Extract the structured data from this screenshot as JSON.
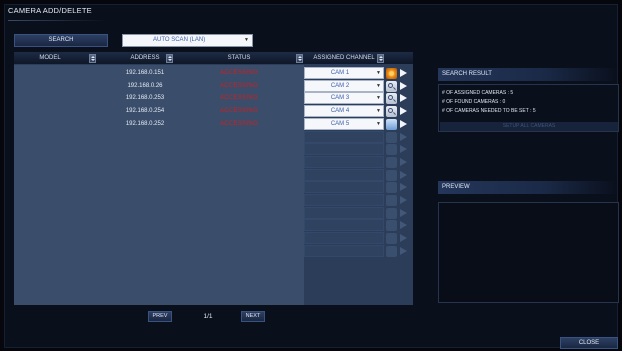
{
  "window": {
    "title": "CAMERA ADD/DELETE"
  },
  "toolbar": {
    "search_label": "SEARCH",
    "scan_mode": "AUTO SCAN (LAN)"
  },
  "table": {
    "columns": {
      "model": "MODEL",
      "address": "ADDRESS",
      "status": "STATUS",
      "channel": "ASSIGNED CHANNEL"
    },
    "rows": [
      {
        "address": "192.168.0.151",
        "status": "ACCESSING",
        "channel": "CAM 1",
        "icon": "camera-orange-icon"
      },
      {
        "address": "192.168.0.26",
        "status": "ACCESSING",
        "channel": "CAM 2",
        "icon": "magnifier-icon"
      },
      {
        "address": "192.168.0.253",
        "status": "ACCESSING",
        "channel": "CAM 3",
        "icon": "magnifier-icon"
      },
      {
        "address": "192.168.0.254",
        "status": "ACCESSING",
        "channel": "CAM 4",
        "icon": "magnifier-icon"
      },
      {
        "address": "192.168.0.252",
        "status": "ACCESSING",
        "channel": "CAM 5",
        "icon": "camera-blue-icon"
      }
    ],
    "empty_rows": 10
  },
  "pager": {
    "prev": "PREV",
    "page": "1/1",
    "next": "NEXT"
  },
  "search_result": {
    "title": "SEARCH RESULT",
    "lines": [
      "# OF ASSIGNED CAMERAS : 5",
      "# OF FOUND CAMERAS : 0",
      "# OF CAMERAS NEEDED TO BE SET : 5"
    ],
    "setup_all": "SETUP ALL CAMERAS"
  },
  "preview": {
    "title": "PREVIEW"
  },
  "footer": {
    "close_label": "CLOSE"
  },
  "colors": {
    "status_red": "#d11d1d",
    "select_text": "#3a5fa8",
    "grid_bg": "#3a4e6b"
  }
}
